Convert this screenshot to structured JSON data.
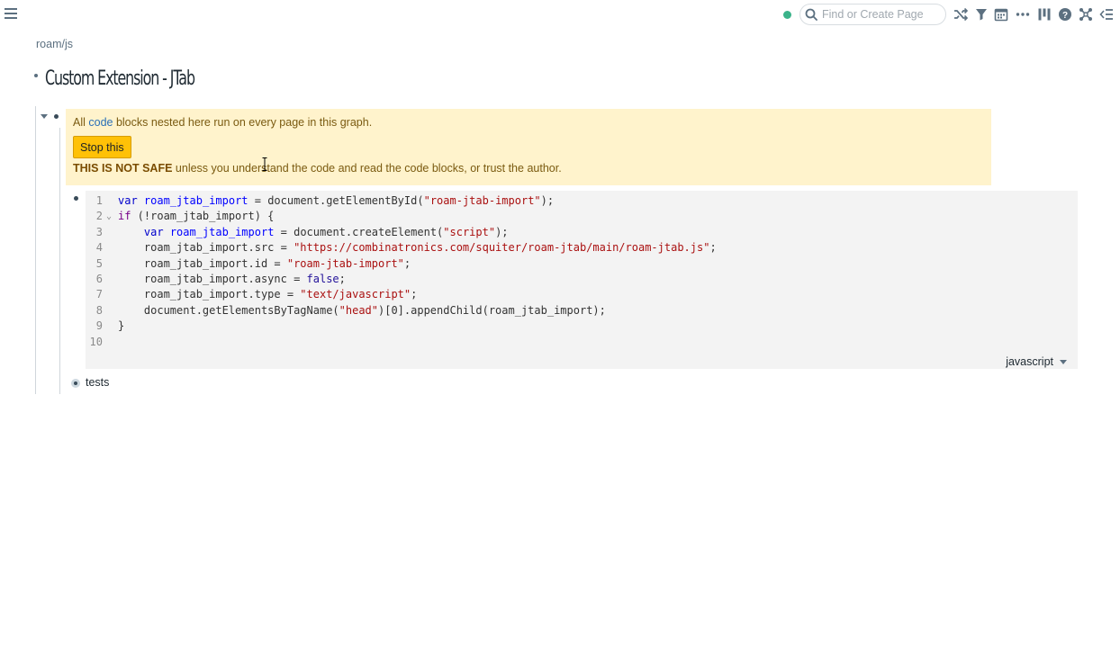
{
  "topbar": {
    "search_placeholder": "Find or Create Page",
    "icons": [
      "menu-icon",
      "sync-status-icon",
      "search-icon",
      "shuffle-icon",
      "filter-icon",
      "daily-notes-icon",
      "more-icon",
      "right-sidebar-icon",
      "help-icon",
      "graph-icon",
      "left-sidebar-icon"
    ]
  },
  "page": {
    "breadcrumb": "roam/js",
    "title": "Custom Extension - JTab"
  },
  "warning": {
    "prefix": "All ",
    "link": "code",
    "suffix": " blocks nested here run on every page in this graph.",
    "button": "Stop this",
    "bold": "THIS IS NOT SAFE",
    "rest": " unless you understand the code and read the code blocks, or trust the author."
  },
  "code": {
    "language": "javascript",
    "line_numbers": [
      "1",
      "2",
      "3",
      "4",
      "5",
      "6",
      "7",
      "8",
      "9",
      "10"
    ],
    "lines": [
      "var roam_jtab_import = document.getElementById(\"roam-jtab-import\");",
      "if (!roam_jtab_import) {",
      "    var roam_jtab_import = document.createElement(\"script\");",
      "    roam_jtab_import.src = \"https://combinatronics.com/squiter/roam-jtab/main/roam-jtab.js\";",
      "    roam_jtab_import.id = \"roam-jtab-import\";",
      "    roam_jtab_import.async = false;",
      "    roam_jtab_import.type = \"text/javascript\";",
      "    document.getElementsByTagName(\"head\")[0].appendChild(roam_jtab_import);",
      "}",
      ""
    ]
  },
  "blocks": {
    "tests": "tests"
  },
  "colors": {
    "warning_bg": "#fff3cc",
    "button": "#ffc107",
    "link": "#2a6fb7",
    "sync": "#3bb38a"
  }
}
